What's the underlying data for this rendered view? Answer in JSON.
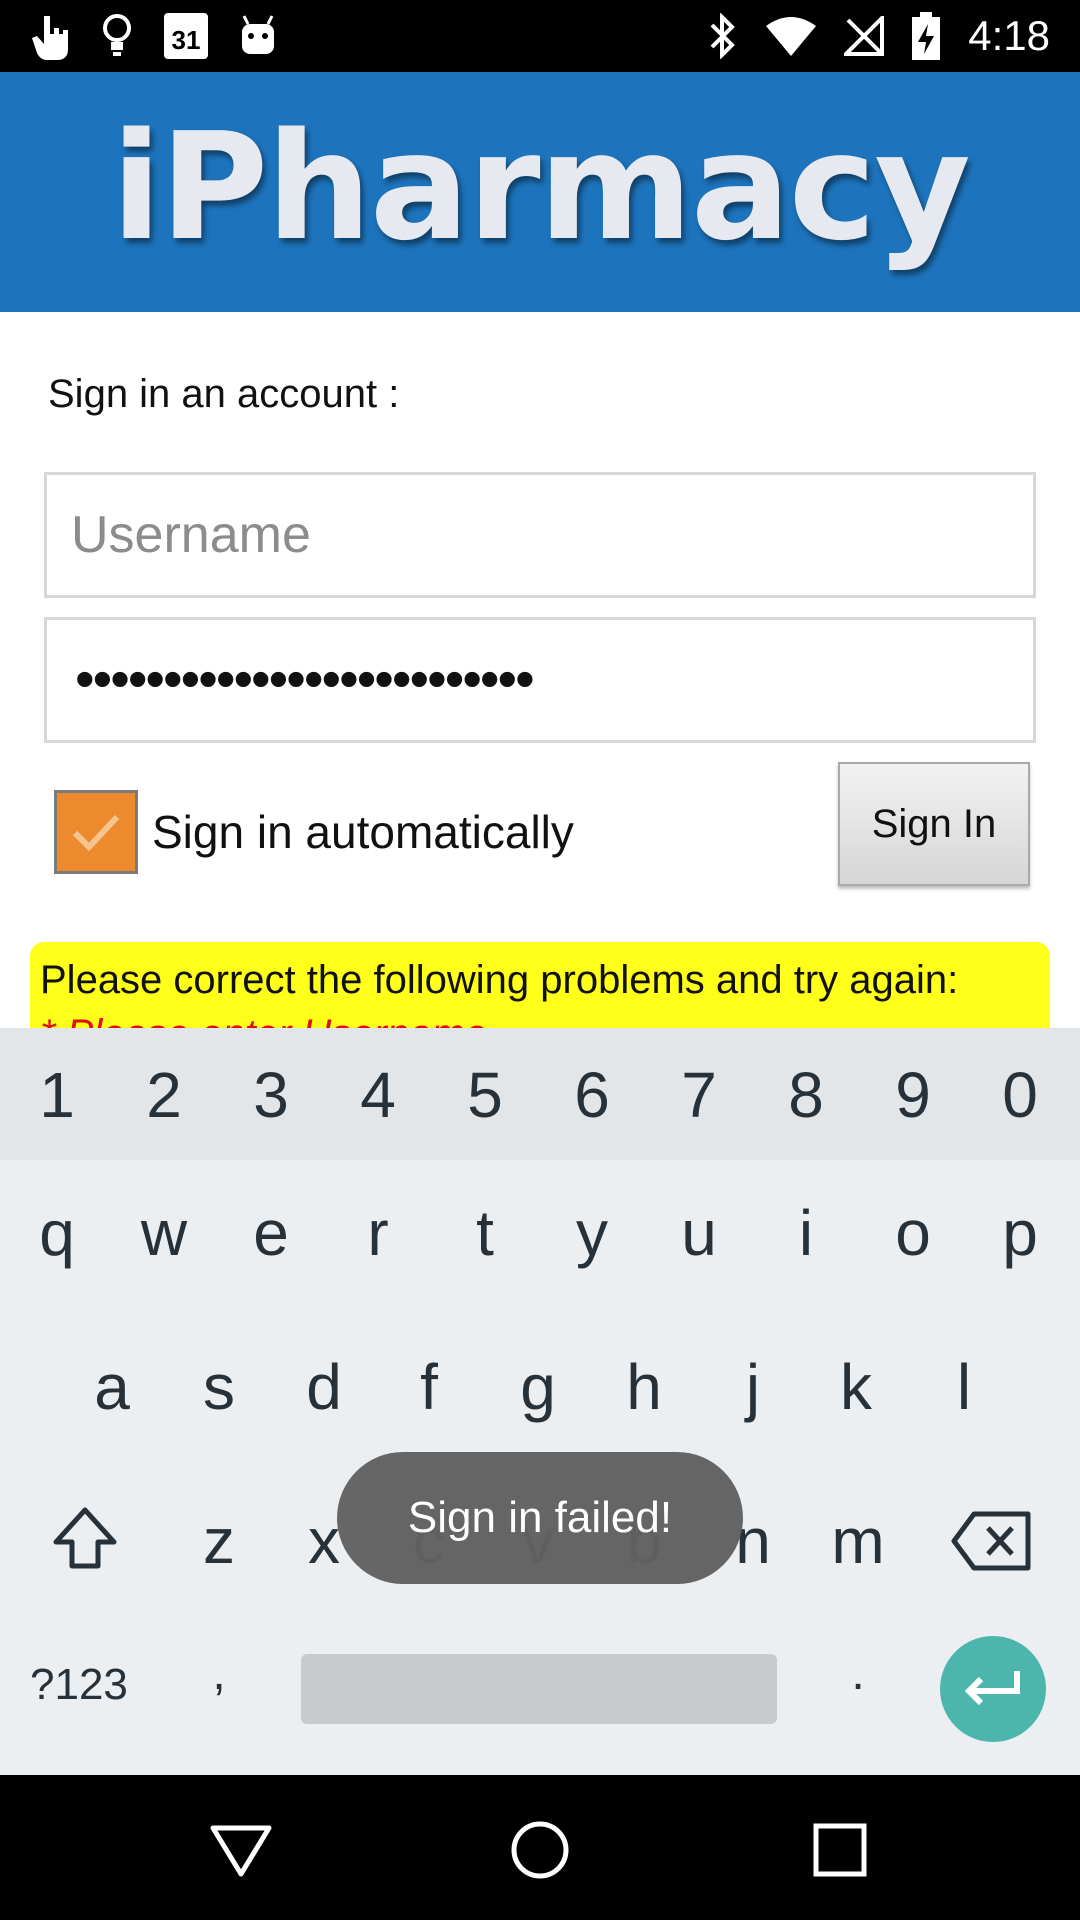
{
  "status_bar": {
    "time": "4:18",
    "calendar_day": "31",
    "left_icons": [
      "touch-icon",
      "lightbulb-icon",
      "calendar-icon",
      "android-icon"
    ],
    "right_icons": [
      "bluetooth-icon",
      "wifi-icon",
      "no-signal-icon",
      "battery-charging-icon"
    ]
  },
  "banner": {
    "brand": "iPharmacy",
    "color": "#1d74bd"
  },
  "form": {
    "prompt": "Sign in an account :",
    "username_placeholder": "Username",
    "username_value": "",
    "password_mask": "••••••••••••••••••••••••••",
    "auto_signin_label": "Sign in automatically",
    "auto_signin_checked": true,
    "signin_button": "Sign In"
  },
  "error": {
    "message": "Please correct the following problems and try again:",
    "detail_partial": "* Please enter Username",
    "box_color": "#ffff1a"
  },
  "keyboard": {
    "numbers": [
      "1",
      "2",
      "3",
      "4",
      "5",
      "6",
      "7",
      "8",
      "9",
      "0"
    ],
    "row1": [
      "q",
      "w",
      "e",
      "r",
      "t",
      "y",
      "u",
      "i",
      "o",
      "p"
    ],
    "row2": [
      "a",
      "s",
      "d",
      "f",
      "g",
      "h",
      "j",
      "k",
      "l"
    ],
    "row3": [
      "z",
      "x",
      "c",
      "v",
      "b",
      "n",
      "m"
    ],
    "symbols_key": "?123",
    "comma_key": ",",
    "period_key": ".",
    "enter_color": "#4db6ac"
  },
  "toast": {
    "message": "Sign in failed!"
  },
  "nav": [
    "back-icon",
    "home-icon",
    "recents-icon"
  ]
}
